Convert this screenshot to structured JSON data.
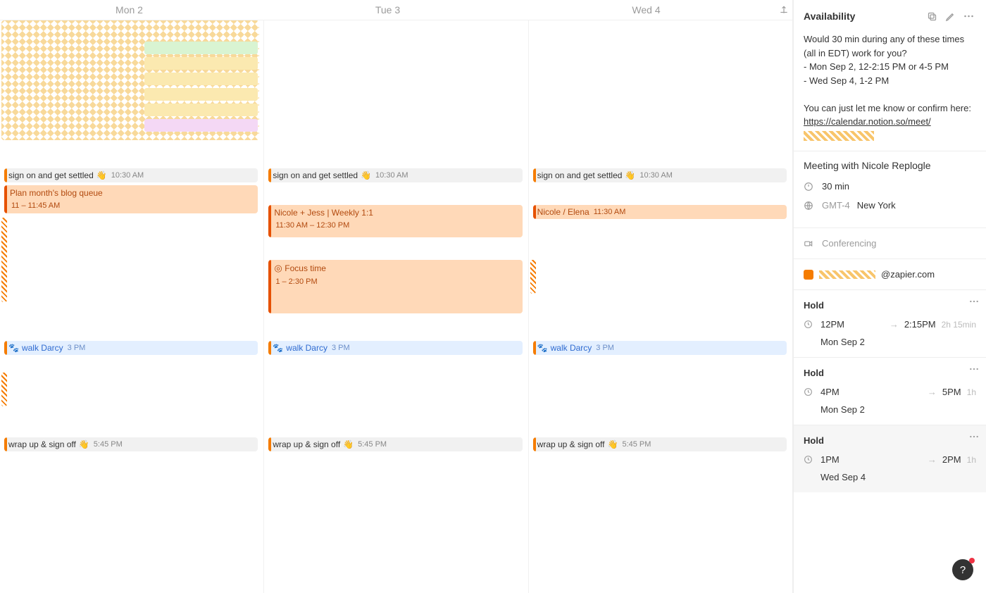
{
  "days": [
    {
      "label": "Mon 2",
      "today": false
    },
    {
      "label": "Tue 3",
      "today": false
    },
    {
      "label": "Wed 4",
      "today": false
    }
  ],
  "all_day_mon_bars": [
    {
      "bg": "#d9f4d2"
    },
    {
      "bg": "#fbe9b0"
    },
    {
      "bg": "#fbe9b0"
    },
    {
      "bg": "#fbe9b0"
    },
    {
      "bg": "#fbe9b0"
    },
    {
      "bg": "#f4d8f5"
    }
  ],
  "events": {
    "sign_on": {
      "title": "sign on and get settled",
      "emoji": "👋",
      "time": "10:30 AM"
    },
    "plan_month": {
      "title": "Plan month's blog queue",
      "time": "11 – 11:45 AM"
    },
    "weekly_11": {
      "title": "Nicole + Jess | Weekly 1:1",
      "time": "11:30 AM – 12:30 PM"
    },
    "nicole_elena": {
      "title": "Nicole / Elena",
      "time": "11:30 AM"
    },
    "focus_time": {
      "title": "Focus time",
      "icon": "◎",
      "time": "1 – 2:30 PM"
    },
    "walk_darcy": {
      "title": "walk Darcy",
      "emoji": "🐾",
      "time": "3 PM"
    },
    "wrap_up": {
      "title": "wrap up & sign off",
      "emoji": "👋",
      "time": "5:45 PM"
    }
  },
  "sidebar": {
    "title": "Availability",
    "body": {
      "l1": "Would 30 min during any of these times (all in EDT) work for you?",
      "l2": "- Mon Sep 2, 12-2:15 PM or 4-5 PM",
      "l3": "- Wed Sep 4, 1-2 PM",
      "l4": "You can just let me know or confirm here:",
      "link": "https://calendar.notion.so/meet/"
    },
    "meeting_with": "Meeting with Nicole Replogle",
    "duration": "30 min",
    "tz_prefix": "GMT-4",
    "tz_city": "New York",
    "conferencing": "Conferencing",
    "account_suffix": "@zapier.com",
    "holds": [
      {
        "title": "Hold",
        "start": "12PM",
        "end": "2:15PM",
        "dur": "2h 15min",
        "date": "Mon Sep 2",
        "selected": false
      },
      {
        "title": "Hold",
        "start": "4PM",
        "end": "5PM",
        "dur": "1h",
        "date": "Mon Sep 2",
        "selected": false
      },
      {
        "title": "Hold",
        "start": "1PM",
        "end": "2PM",
        "dur": "1h",
        "date": "Wed Sep 4",
        "selected": true
      }
    ]
  }
}
